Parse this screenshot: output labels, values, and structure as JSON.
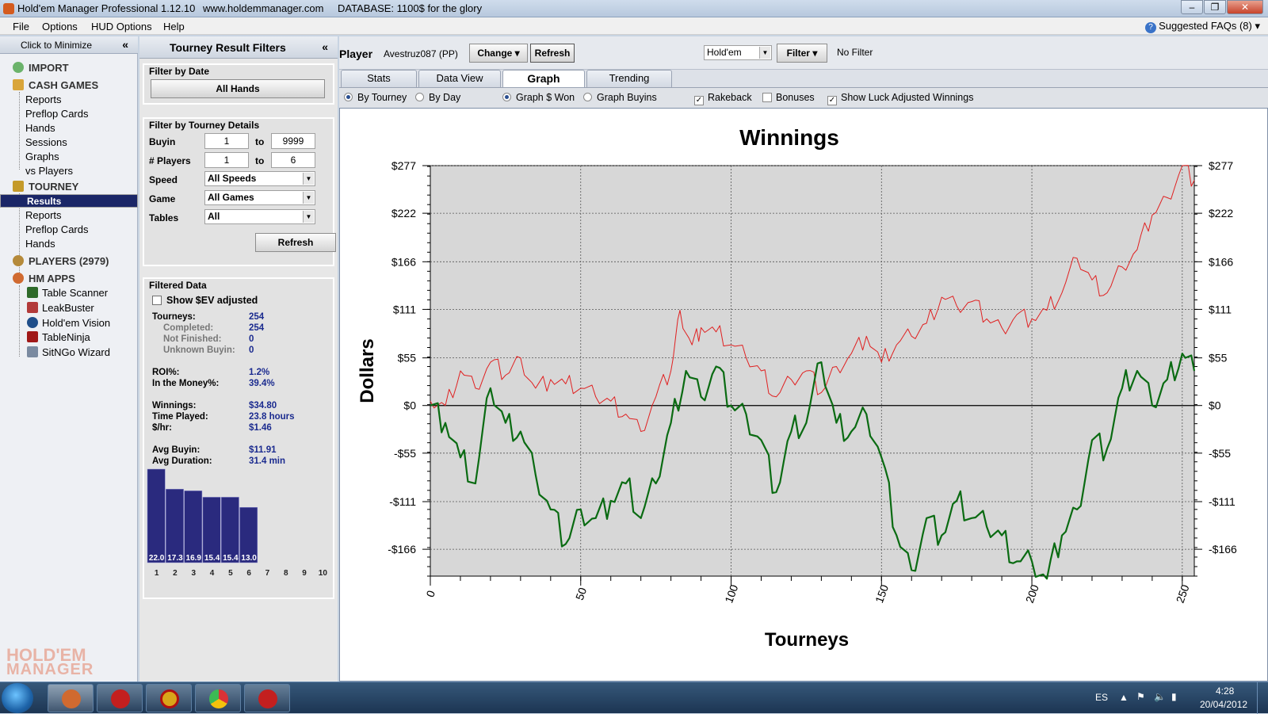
{
  "titlebar": {
    "app": "Hold'em Manager Professional 1.12.10",
    "site": "www.holdemmanager.com",
    "database": "DATABASE: 1100$ for the glory"
  },
  "menu": {
    "items": [
      "File",
      "Options",
      "HUD Options",
      "Help"
    ],
    "faq": "Suggested FAQs (8)"
  },
  "nav": {
    "minimize": "Click to Minimize",
    "import": "IMPORT",
    "cash_games": "CASH GAMES",
    "cash_items": [
      "Reports",
      "Preflop Cards",
      "Hands",
      "Sessions",
      "Graphs",
      "vs Players"
    ],
    "tourney": "TOURNEY",
    "tourney_items": [
      "Results",
      "Reports",
      "Preflop Cards",
      "Hands"
    ],
    "players": "PLAYERS (2979)",
    "hm_apps": "HM APPS",
    "apps": [
      "Table Scanner",
      "LeakBuster",
      "Hold'em Vision",
      "TableNinja",
      "SitNGo Wizard"
    ],
    "logo_top": "HOLD'EM",
    "logo_bottom": "MANAGER"
  },
  "filters": {
    "title": "Tourney Result Filters",
    "by_date": "Filter by Date",
    "all_hands": "All Hands",
    "by_details": "Filter by Tourney Details",
    "buyin_label": "Buyin",
    "buyin_from": "1",
    "buyin_to": "9999",
    "players_label": "# Players",
    "players_from": "1",
    "players_to": "6",
    "to": "to",
    "speed_label": "Speed",
    "speed": "All Speeds",
    "game_label": "Game",
    "game": "All Games",
    "tables_label": "Tables",
    "tables": "All",
    "refresh": "Refresh",
    "filtered_data": "Filtered Data",
    "show_ev": "Show $EV adjusted",
    "stats": [
      {
        "k": "Tourneys:",
        "v": "254",
        "sub": false
      },
      {
        "k": "Completed:",
        "v": "254",
        "sub": true
      },
      {
        "k": "Not Finished:",
        "v": "0",
        "sub": true
      },
      {
        "k": "Unknown Buyin:",
        "v": "0",
        "sub": true
      },
      {
        "k": "ROI%:",
        "v": "1.2%",
        "sub": false
      },
      {
        "k": "In the Money%:",
        "v": "39.4%",
        "sub": false
      },
      {
        "k": "Winnings:",
        "v": "$34.80",
        "sub": false
      },
      {
        "k": "Time Played:",
        "v": "23.8  hours",
        "sub": false
      },
      {
        "k": "$/hr:",
        "v": "$1.46",
        "sub": false
      },
      {
        "k": "Avg Buyin:",
        "v": "$11.91",
        "sub": false
      },
      {
        "k": "Avg Duration:",
        "v": "31.4  min",
        "sub": false
      }
    ],
    "place_chart": {
      "places": [
        "1",
        "2",
        "3",
        "4",
        "5",
        "6",
        "7",
        "8",
        "9",
        "10"
      ],
      "values": [
        22.0,
        17.3,
        16.9,
        15.4,
        15.4,
        13.0
      ],
      "labels": [
        "22.0",
        "17.3",
        "16.9",
        "15.4",
        "15.4",
        "13.0"
      ],
      "bar_color": "#2a2a7e"
    }
  },
  "main": {
    "player_label": "Player",
    "player": "Avestruz087 (PP)",
    "change": "Change",
    "refresh": "Refresh",
    "game": "Hold'em",
    "filter": "Filter",
    "no_filter": "No Filter",
    "tabs": [
      "Stats",
      "Data View",
      "Graph",
      "Trending"
    ],
    "options": {
      "by_tourney": "By Tourney",
      "by_day": "By Day",
      "graph_won": "Graph $ Won",
      "graph_buyins": "Graph Buyins",
      "rakeback": "Rakeback",
      "bonuses": "Bonuses",
      "luck": "Show Luck Adjusted Winnings"
    }
  },
  "chart_data": {
    "type": "line",
    "title": "Winnings",
    "xlabel": "Tourneys",
    "ylabel": "Dollars",
    "xlim": [
      0,
      254
    ],
    "ylim": [
      -197,
      277
    ],
    "xticks": [
      "0",
      "50",
      "100",
      "150",
      "200",
      "250"
    ],
    "xtick_values": [
      0,
      50,
      100,
      150,
      200,
      250
    ],
    "yticks": [
      "$277",
      "$222",
      "$166",
      "$111",
      "$55",
      "$0",
      "-$55",
      "-$111",
      "-$166"
    ],
    "ytick_values": [
      277,
      222,
      166,
      111,
      55,
      0,
      -55,
      -111,
      -166
    ],
    "series": [
      {
        "color": "#e02020",
        "x": [
          0,
          5,
          10,
          15,
          20,
          25,
          30,
          35,
          40,
          45,
          50,
          55,
          60,
          65,
          70,
          75,
          80,
          83,
          87,
          90,
          95,
          100,
          105,
          110,
          115,
          120,
          125,
          130,
          135,
          140,
          145,
          150,
          155,
          160,
          165,
          170,
          175,
          180,
          185,
          190,
          195,
          200,
          205,
          210,
          215,
          220,
          225,
          230,
          235,
          240,
          245,
          250,
          254
        ],
        "y": [
          5,
          0,
          40,
          20,
          50,
          35,
          55,
          20,
          30,
          25,
          20,
          10,
          5,
          -10,
          -30,
          10,
          40,
          110,
          70,
          90,
          85,
          70,
          55,
          40,
          10,
          30,
          40,
          15,
          45,
          60,
          80,
          50,
          70,
          80,
          95,
          125,
          115,
          120,
          100,
          90,
          105,
          100,
          110,
          130,
          170,
          145,
          130,
          160,
          180,
          220,
          240,
          277,
          260
        ]
      },
      {
        "color": "#0a6b12",
        "x": [
          0,
          5,
          10,
          15,
          20,
          25,
          30,
          35,
          40,
          45,
          50,
          55,
          60,
          65,
          70,
          75,
          80,
          85,
          90,
          95,
          100,
          105,
          110,
          115,
          120,
          125,
          130,
          135,
          140,
          145,
          150,
          155,
          160,
          165,
          170,
          175,
          180,
          185,
          190,
          195,
          200,
          205,
          210,
          215,
          220,
          225,
          230,
          235,
          240,
          245,
          250,
          254
        ],
        "y": [
          0,
          -20,
          -60,
          -90,
          20,
          -20,
          -30,
          -80,
          -120,
          -160,
          -120,
          -130,
          -110,
          -90,
          -130,
          -90,
          -20,
          40,
          10,
          45,
          0,
          -10,
          -40,
          -100,
          -30,
          -20,
          50,
          -20,
          -30,
          -10,
          -60,
          -150,
          -190,
          -130,
          -150,
          -110,
          -130,
          -140,
          -150,
          -180,
          -180,
          -200,
          -150,
          -120,
          -40,
          -50,
          20,
          40,
          0,
          30,
          60,
          40
        ]
      }
    ]
  },
  "taskbar": {
    "lang": "ES",
    "time": "4:28",
    "date": "20/04/2012"
  }
}
